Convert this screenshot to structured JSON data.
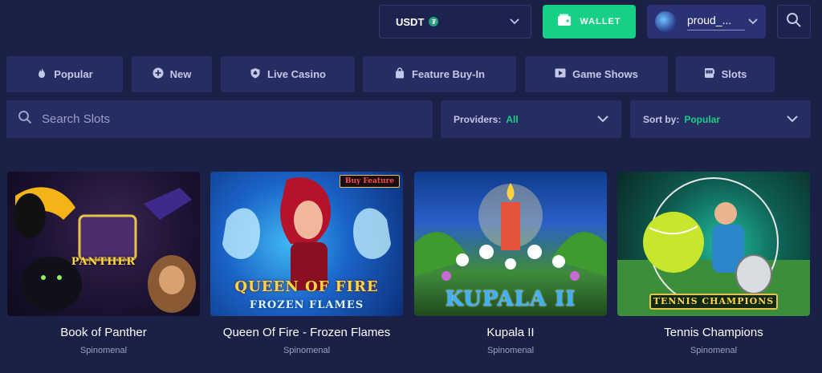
{
  "header": {
    "currency": "USDT",
    "wallet_label": "WALLET",
    "username": "proud_..."
  },
  "categories": [
    {
      "label": "Popular",
      "icon": "flame-icon"
    },
    {
      "label": "New",
      "icon": "plus-circle-icon"
    },
    {
      "label": "Live Casino",
      "icon": "shield-spade-icon"
    },
    {
      "label": "Feature Buy-In",
      "icon": "shopping-bag-icon"
    },
    {
      "label": "Game Shows",
      "icon": "play-icon"
    },
    {
      "label": "Slots",
      "icon": "slot-machine-icon"
    }
  ],
  "filters": {
    "search_placeholder": "Search Slots",
    "providers_label": "Providers:",
    "providers_value": "All",
    "sort_label": "Sort by:",
    "sort_value": "Popular"
  },
  "games": [
    {
      "title": "Book of Panther",
      "provider": "Spinomenal",
      "art_text": "PANTHER"
    },
    {
      "title": "Queen Of Fire - Frozen Flames",
      "provider": "Spinomenal",
      "art_text": "QUEEN OF FIRE",
      "art_subtext": "FROZEN FLAMES",
      "badge": "Buy Feature"
    },
    {
      "title": "Kupala II",
      "provider": "Spinomenal",
      "art_text": "KUPALA II"
    },
    {
      "title": "Tennis Champions",
      "provider": "Spinomenal",
      "art_text": "TENNIS CHAMPIONS"
    }
  ],
  "colors": {
    "background": "#1b2046",
    "panel": "#262d63",
    "accent_green": "#16d086",
    "user_panel": "#2a3175"
  }
}
